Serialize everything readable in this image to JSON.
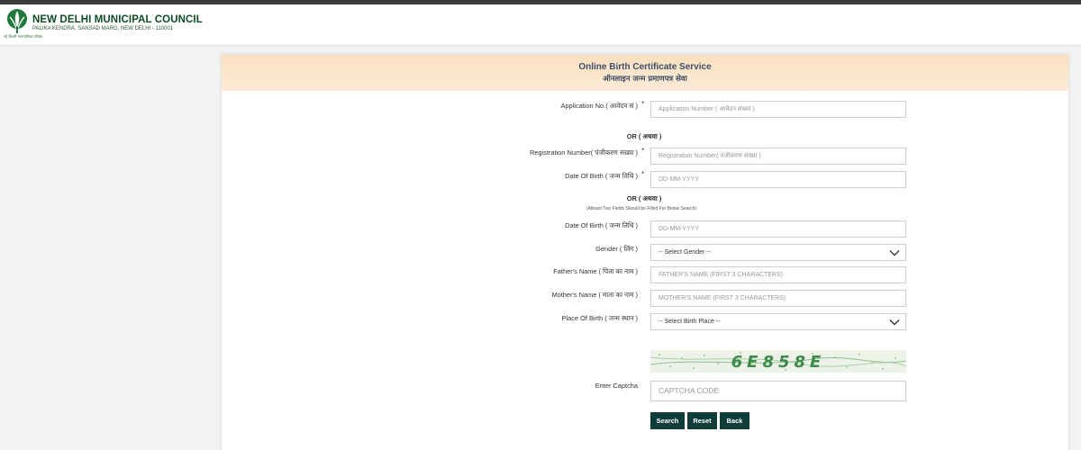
{
  "header": {
    "org_name": "NEW DELHI MUNICIPAL COUNCIL",
    "org_address": "PALIKA KENDRA, SANSAD MARG, NEW DELHI - 110001",
    "logo_caption": "नई दिल्ली नगरपालिका परिषद"
  },
  "card": {
    "title": "Online Birth Certificate Service",
    "subtitle": "ऑनलाइन जन्म प्रमाणपत्र सेवा"
  },
  "form": {
    "application_no": {
      "label": "Application No.( आवेदन सं )",
      "required": "*",
      "placeholder": "Application Number ( आवेदन संख्या )"
    },
    "or_1": "OR ( अथवा )",
    "registration_no": {
      "label": "Registration Number( पंजीकरण संख्या )",
      "required": "*",
      "placeholder": "Registration Number( पंजीकरण संख्या )"
    },
    "dob_1": {
      "label": "Date Of Birth ( जन्म तिथि )",
      "required": "*",
      "placeholder": "DD-MM-YYYY"
    },
    "or_2": "OR ( अथवा )",
    "note": "(Atleast Two Fields Should be Filled For Below Search)",
    "dob_2": {
      "label": "Date Of Birth ( जन्म तिथि )",
      "placeholder": "DD-MM-YYYY"
    },
    "gender": {
      "label": "Gender ( लिंग )",
      "selected": "-- Select Gender --"
    },
    "father": {
      "label": "Father's Name ( पिता का नाम )",
      "placeholder": "FATHER'S NAME (FIRST 3 CHARACTERS)"
    },
    "mother": {
      "label": "Mother's Name ( माता का नाम )",
      "placeholder": "MOTHER'S NAME (FIRST 3 CHARACTERS)"
    },
    "birth_place": {
      "label": "Place Of Birth ( जन्म स्थान )",
      "selected": "-- Select Birth Place --"
    },
    "captcha": {
      "label": "Enter Captcha",
      "image_text": "6E858E",
      "placeholder": "CAPTCHA CODE"
    }
  },
  "buttons": {
    "search": "Search",
    "reset": "Reset",
    "back": "Back"
  },
  "colors": {
    "header_green": "#0d4a25",
    "card_header": "#fbe0bf",
    "button": "#0f3d3a",
    "captcha_text": "#3d8a4a"
  },
  "icons": {
    "select_arrow": "chevron-down-icon",
    "logo": "ndmc-tree-logo-icon"
  }
}
